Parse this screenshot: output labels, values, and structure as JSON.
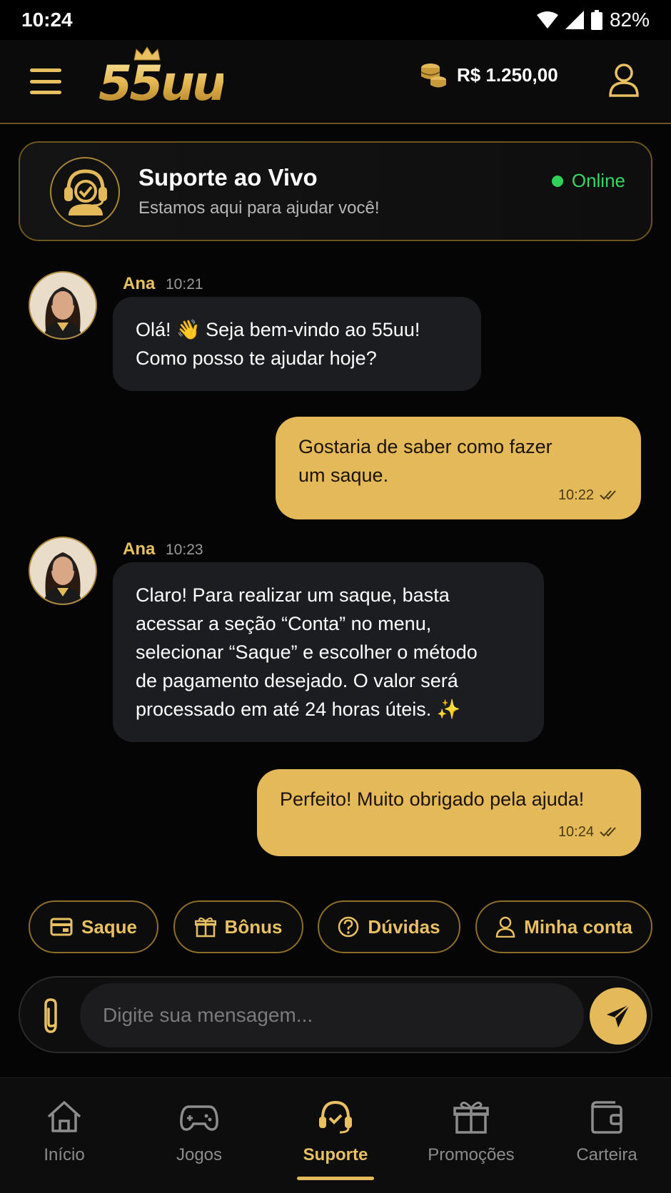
{
  "status_bar": {
    "time": "10:24",
    "battery": "82%"
  },
  "header": {
    "logo": "55uu",
    "balance": "R$ 1.250,00"
  },
  "support": {
    "title": "Suporte ao Vivo",
    "subtitle": "Estamos aqui para ajudar você!",
    "status": "Online"
  },
  "messages": [
    {
      "from": "agent",
      "name": "Ana",
      "time": "10:21",
      "lines": [
        "Olá! 👋 Seja bem-vindo ao 55uu!",
        "Como posso te ajudar hoje?"
      ]
    },
    {
      "from": "user",
      "time": "10:22",
      "lines": [
        "Gostaria de saber como fazer",
        "um saque."
      ]
    },
    {
      "from": "agent",
      "name": "Ana",
      "time": "10:23",
      "lines": [
        "Claro! Para realizar um saque, basta",
        "acessar a seção “Conta” no menu,",
        "selecionar “Saque” e escolher o método",
        "de pagamento desejado. O valor será",
        "processado em até 24 horas úteis. ✨"
      ]
    },
    {
      "from": "user",
      "time": "10:24",
      "lines": [
        "Perfeito! Muito obrigado pela ajuda!"
      ]
    }
  ],
  "quick_actions": [
    {
      "label": "Saque",
      "icon": "card-icon"
    },
    {
      "label": "Bônus",
      "icon": "gift-icon"
    },
    {
      "label": "Dúvidas",
      "icon": "question-icon"
    },
    {
      "label": "Minha conta",
      "icon": "user-icon"
    }
  ],
  "composer": {
    "placeholder": "Digite sua mensagem..."
  },
  "nav": [
    {
      "label": "Início",
      "icon": "home-icon",
      "active": false
    },
    {
      "label": "Jogos",
      "icon": "gamepad-icon",
      "active": false
    },
    {
      "label": "Suporte",
      "icon": "headset-icon",
      "active": true
    },
    {
      "label": "Promoções",
      "icon": "gift-icon",
      "active": false
    },
    {
      "label": "Carteira",
      "icon": "wallet-icon",
      "active": false
    }
  ],
  "colors": {
    "accent": "#e4b95a",
    "online": "#35d863",
    "background": "#050505"
  }
}
